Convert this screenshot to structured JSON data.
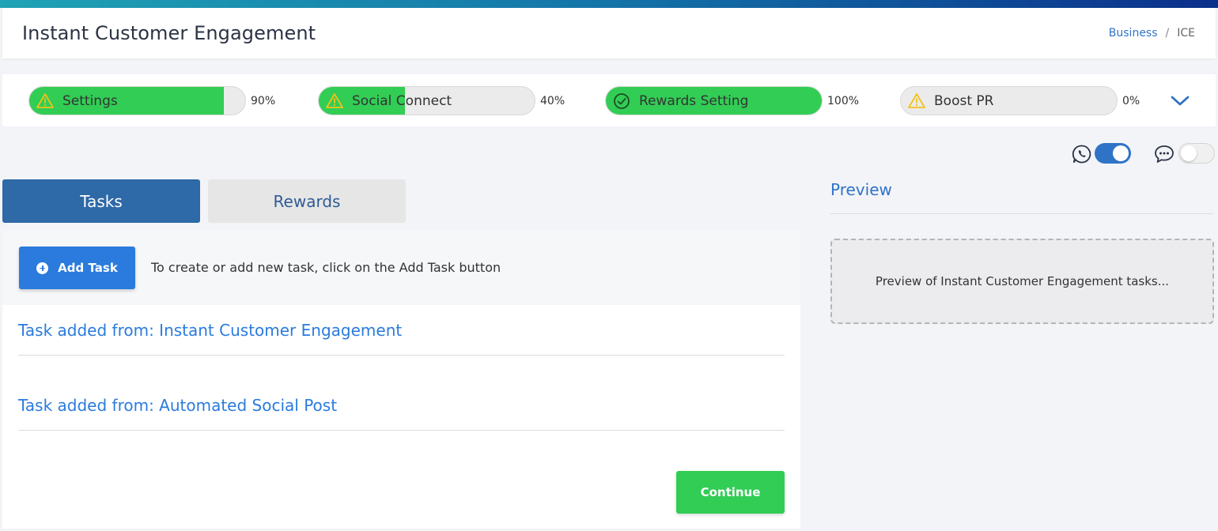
{
  "header": {
    "title": "Instant Customer Engagement",
    "breadcrumb": {
      "parent": "Business",
      "separator": "/",
      "current": "ICE"
    }
  },
  "progress_steps": [
    {
      "label": "Settings",
      "percent_text": "90%",
      "progress": 0.9,
      "status": "warning"
    },
    {
      "label": "Social Connect",
      "percent_text": "40%",
      "progress": 0.4,
      "status": "warning"
    },
    {
      "label": "Rewards Setting",
      "percent_text": "100%",
      "progress": 1.0,
      "status": "complete"
    },
    {
      "label": "Boost PR",
      "percent_text": "0%",
      "progress": 0.0,
      "status": "warning"
    }
  ],
  "channels": {
    "whatsapp": {
      "icon": "whatsapp-icon",
      "enabled": true
    },
    "sms": {
      "icon": "chat-bubble-icon",
      "enabled": false
    }
  },
  "tabs": [
    {
      "label": "Tasks",
      "active": true
    },
    {
      "label": "Rewards",
      "active": false
    }
  ],
  "tasks_panel": {
    "add_button_label": "Add Task",
    "hint": "To create or add new task, click on the Add Task button",
    "tasks": [
      "Task added from: Instant Customer Engagement",
      "Task added from: Automated Social Post"
    ],
    "continue_label": "Continue"
  },
  "preview": {
    "title": "Preview",
    "placeholder": "Preview of Instant Customer Engagement tasks..."
  },
  "colors": {
    "primary": "#2a7bdd",
    "success": "#32cd55",
    "tab_active": "#2e69a8",
    "warning_icon": "#f2c218"
  }
}
